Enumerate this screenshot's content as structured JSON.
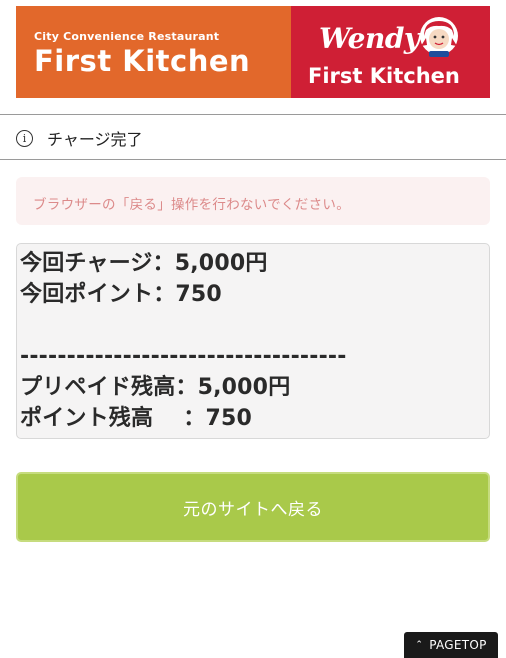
{
  "header": {
    "fk_logo": {
      "tagline": "City Convenience Restaurant",
      "name": "First Kitchen"
    },
    "wendys_logo": {
      "brand": "Wendy's",
      "name": "First Kitchen"
    }
  },
  "page": {
    "title": "チャージ完了"
  },
  "warning": {
    "text": "ブラウザーの「戻る」操作を行わないでください。"
  },
  "summary": {
    "lines": [
      "今回チャージ：5,000円",
      "今回ポイント：750",
      "",
      "-----------------------------------",
      "プリペイド残高：5,000円",
      "ポイント残高　 ：750"
    ]
  },
  "actions": {
    "back_label": "元のサイトへ戻る"
  },
  "pagetop": {
    "label": "PAGETOP"
  },
  "colors": {
    "fk_orange": "#e2682b",
    "wendys_red": "#cf1f35",
    "button_green": "#a9c94a",
    "warning_text": "#dc8a8a"
  }
}
